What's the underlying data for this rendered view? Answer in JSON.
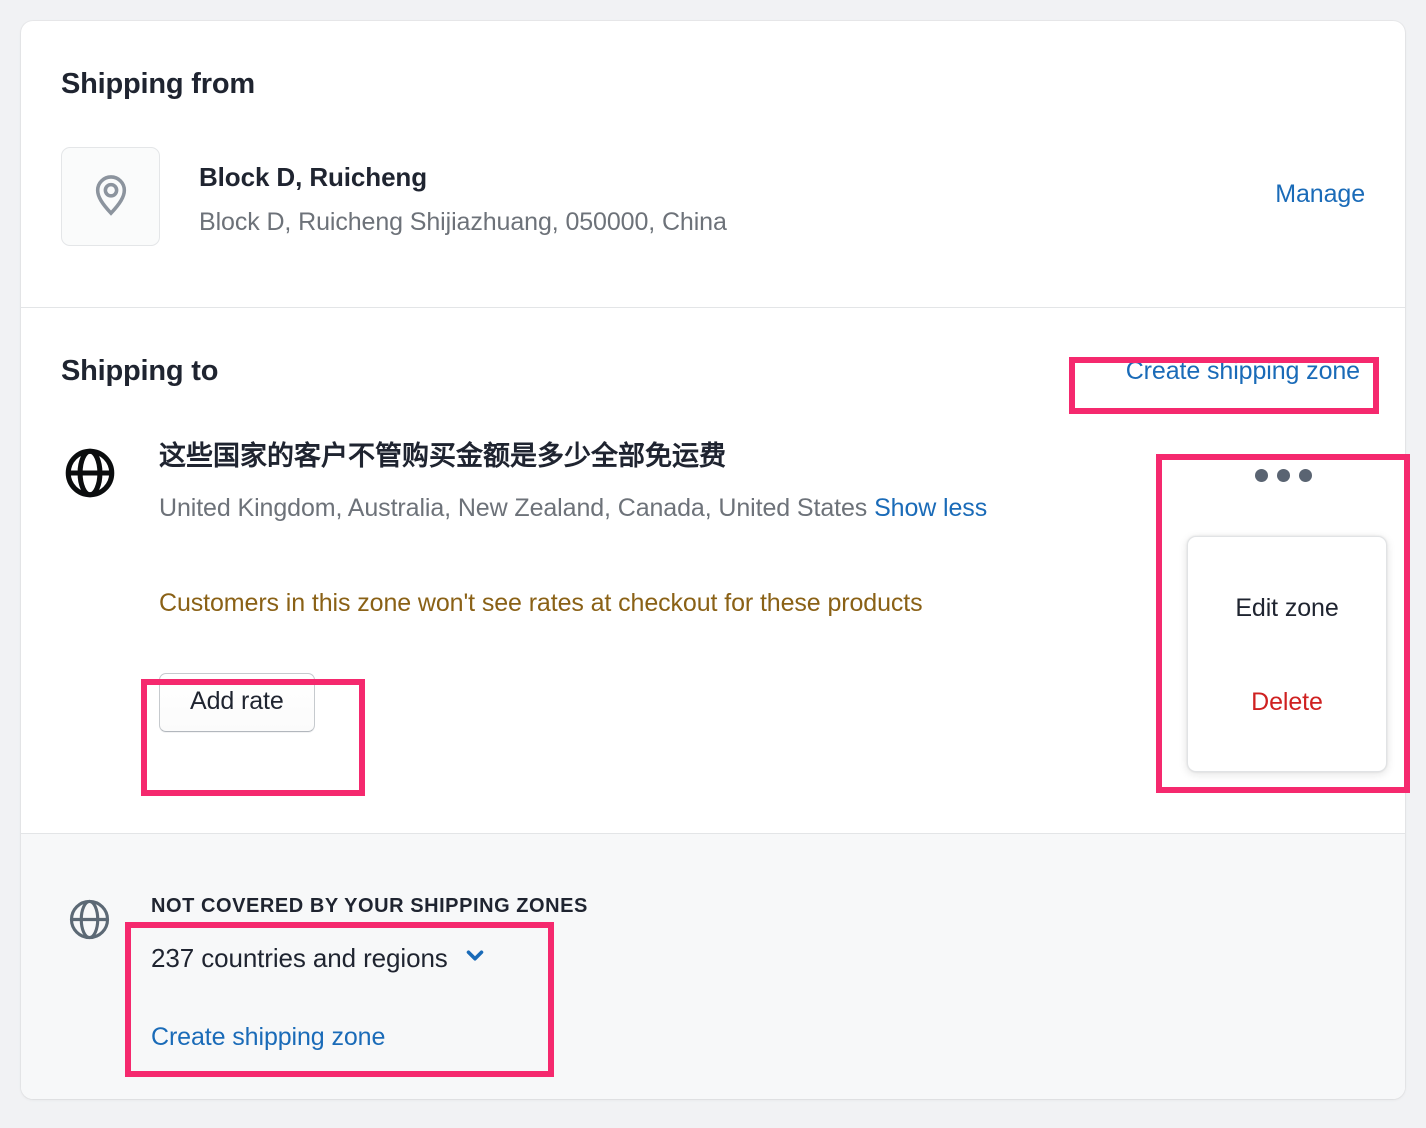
{
  "shipping_from": {
    "section_title": "Shipping from",
    "location_icon": "location-pin-icon",
    "location_name": "Block D, Ruicheng",
    "location_address": "Block D, Ruicheng Shijiazhuang, 050000, China",
    "manage_label": "Manage"
  },
  "shipping_to": {
    "section_title": "Shipping to",
    "create_zone_label": "Create shipping zone",
    "zone": {
      "icon": "globe-icon",
      "title": "这些国家的客户不管购买金额是多少全部免运费",
      "countries": "United Kingdom, Australia, New Zealand, Canada, United States",
      "show_less_label": "Show less",
      "warning": "Customers in this zone won't see rates at checkout for these products",
      "add_rate_label": "Add rate",
      "menu_icon": "kebab-menu-icon",
      "menu": {
        "edit_label": "Edit zone",
        "delete_label": "Delete"
      }
    }
  },
  "not_covered": {
    "icon": "globe-icon",
    "label": "NOT COVERED BY YOUR SHIPPING ZONES",
    "count_label": "237 countries and regions",
    "chevron_icon": "chevron-down-icon",
    "create_zone_label": "Create shipping zone"
  },
  "colors": {
    "link": "#1a6bb8",
    "warning_text": "#8a6116",
    "delete_text": "#cf2121",
    "annotation_highlight": "#f5296e",
    "text_primary": "#1f2430",
    "text_secondary": "#6d7279",
    "page_background": "#f1f2f4",
    "subsection_background": "#f7f8f9"
  }
}
